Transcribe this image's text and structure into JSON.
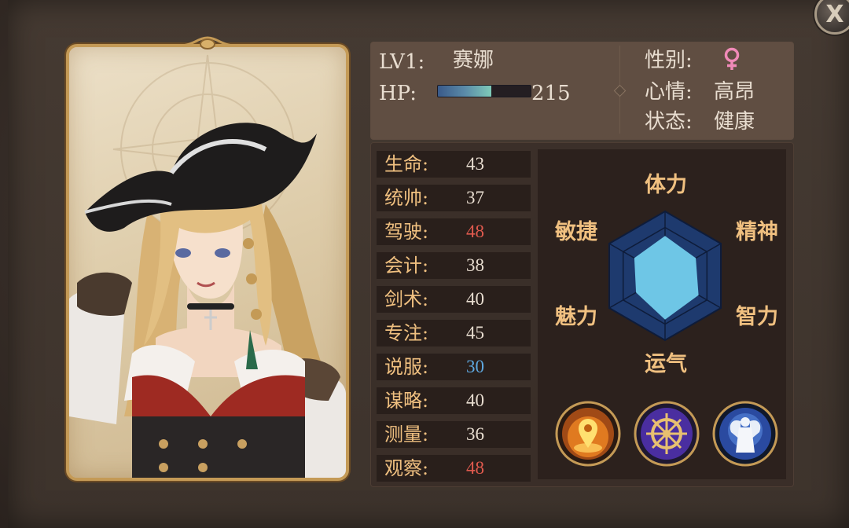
{
  "character": {
    "level": "LV1:",
    "name": "赛娜",
    "hp_label": "HP:",
    "hp_value": "215",
    "hp_fill_fraction": 0.58,
    "gender_label": "性别:",
    "gender_icon": "female-symbol-icon",
    "mood_label": "心情:",
    "mood_value": "高昂",
    "status_label": "状态:",
    "status_value": "健康"
  },
  "stats": [
    {
      "label": "生命:",
      "value": "43",
      "color": "#e8ddd0"
    },
    {
      "label": "统帅:",
      "value": "37",
      "color": "#e8ddd0"
    },
    {
      "label": "驾驶:",
      "value": "48",
      "color": "#e05a4e"
    },
    {
      "label": "会计:",
      "value": "38",
      "color": "#e8ddd0"
    },
    {
      "label": "剑术:",
      "value": "40",
      "color": "#e8ddd0"
    },
    {
      "label": "专注:",
      "value": "45",
      "color": "#e8ddd0"
    },
    {
      "label": "说服:",
      "value": "30",
      "color": "#5ea8e0"
    },
    {
      "label": "谋略:",
      "value": "40",
      "color": "#e8ddd0"
    },
    {
      "label": "测量:",
      "value": "36",
      "color": "#e8ddd0"
    },
    {
      "label": "观察:",
      "value": "48",
      "color": "#e05a4e"
    }
  ],
  "radar": {
    "axes": [
      "体力",
      "精神",
      "智力",
      "运气",
      "魅力",
      "敏捷"
    ],
    "values_fraction": [
      0.62,
      0.55,
      0.6,
      0.68,
      0.52,
      0.55
    ],
    "fill_color": "#6ec6e6",
    "grid_color": "#1e3a6e"
  },
  "skills": [
    {
      "icon": "location-pin-icon"
    },
    {
      "icon": "ship-wheel-icon"
    },
    {
      "icon": "angel-statue-icon"
    }
  ],
  "close_label": "X"
}
